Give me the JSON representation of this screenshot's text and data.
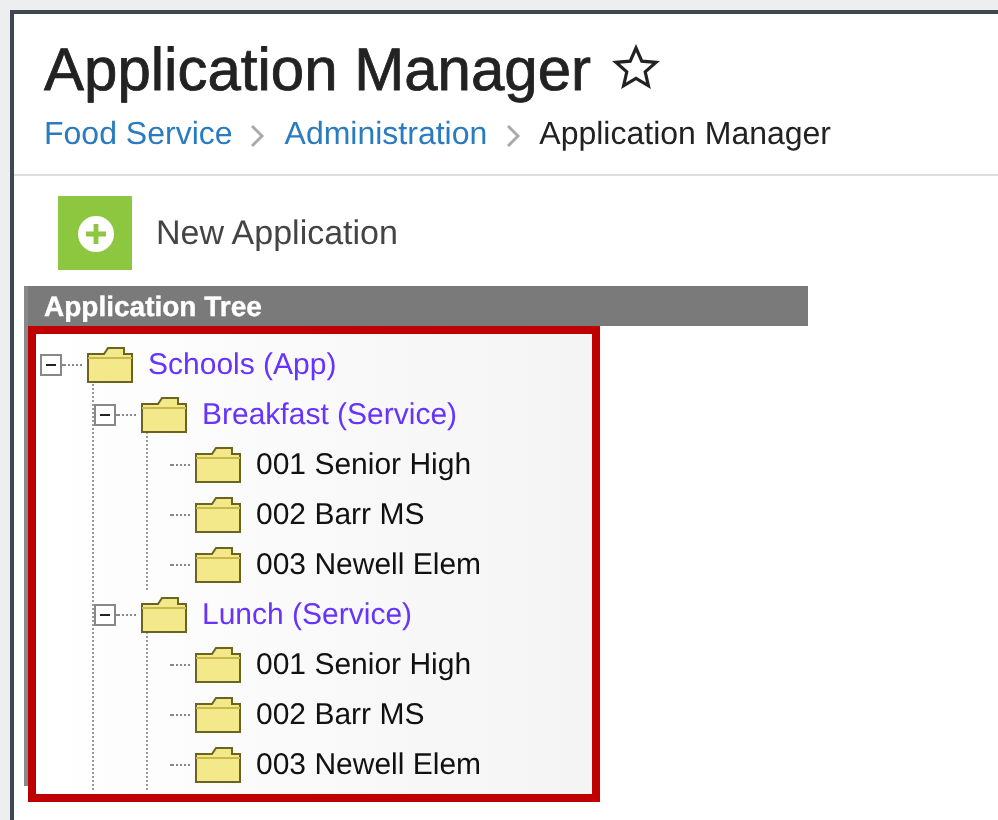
{
  "header": {
    "title": "Application Manager",
    "favorite": false,
    "breadcrumbs": [
      {
        "label": "Food Service",
        "link": true
      },
      {
        "label": "Administration",
        "link": true
      },
      {
        "label": "Application Manager",
        "link": false
      }
    ]
  },
  "toolbar": {
    "button": "New Application"
  },
  "tree_panel": {
    "title": "Application Tree",
    "items": [
      {
        "label": "Schools (App)",
        "expanded": true,
        "children": [
          {
            "label": "Breakfast (Service)",
            "expanded": true,
            "children": [
              {
                "label": "001 Senior High"
              },
              {
                "label": "002 Barr MS"
              },
              {
                "label": "003 Newell Elem"
              }
            ]
          },
          {
            "label": "Lunch (Service)",
            "expanded": true,
            "children": [
              {
                "label": "001 Senior High"
              },
              {
                "label": "002 Barr MS"
              },
              {
                "label": "003 Newell Elem"
              }
            ]
          }
        ]
      }
    ]
  }
}
